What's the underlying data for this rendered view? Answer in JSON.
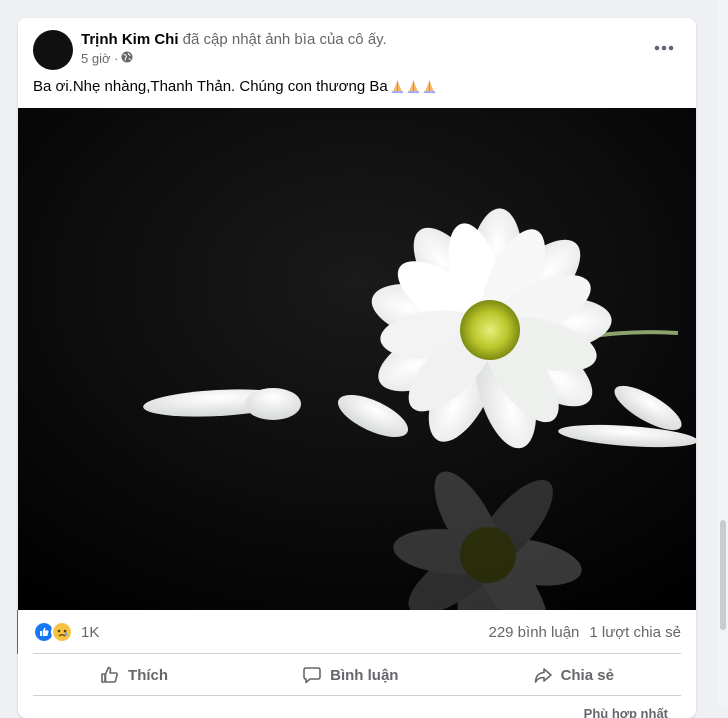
{
  "post": {
    "author_name": "Trịnh Kim Chi",
    "action_text": "đã cập nhật ảnh bìa của cô ấy.",
    "time": "5 giờ ·",
    "caption": "Ba ơi.Nhẹ nhàng,Thanh Thản. Chúng con thương Ba",
    "caption_emoji": "folded-hands-icon x3"
  },
  "stats": {
    "reaction_count": "1K",
    "comments": "229 bình luận",
    "shares": "1 lượt chia sẻ",
    "reaction_icons": [
      "like-icon",
      "sad-icon"
    ]
  },
  "actions": {
    "like": "Thích",
    "comment": "Bình luận",
    "share": "Chia sẻ"
  },
  "footer": {
    "more_comments": "Phù hợp nhất"
  },
  "colors": {
    "accent": "#1877f2",
    "text_secondary": "#65676b",
    "card_bg": "#ffffff",
    "page_bg": "#eef0f3"
  }
}
